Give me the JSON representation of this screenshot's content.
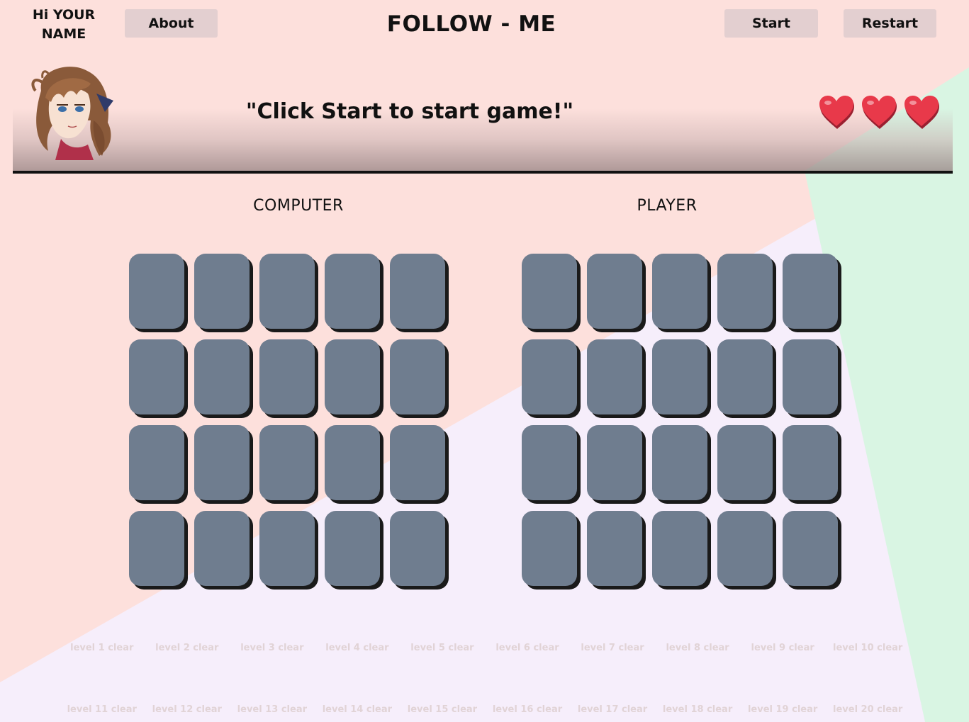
{
  "header": {
    "greeting_line1": "Hi YOUR",
    "greeting_line2": "NAME",
    "title": "FOLLOW - ME",
    "about_label": "About",
    "start_label": "Start",
    "restart_label": "Restart"
  },
  "banner": {
    "avatar_icon": "anime-character-portrait-icon",
    "message": "\"Click Start to start game!\"",
    "lives": 3,
    "heart_icon": "heart-icon",
    "heart_color": "#e8394a"
  },
  "boards": {
    "computer_label": "COMPUTER",
    "player_label": "PLAYER",
    "tile_color": "#6f7d8f"
  },
  "levels": [
    "level 1 clear",
    "level 2 clear",
    "level 3 clear",
    "level 4 clear",
    "level 5 clear",
    "level 6 clear",
    "level 7 clear",
    "level 8 clear",
    "level 9 clear",
    "level 10 clear",
    "level 11 clear",
    "level 12 clear",
    "level 13 clear",
    "level 14 clear",
    "level 15 clear",
    "level 16 clear",
    "level 17 clear",
    "level 18 clear",
    "level 19 clear",
    "level 20 clear"
  ],
  "background_colors": {
    "pink": "#fde0dc",
    "lavender": "#f6eefb",
    "mint": "#d9f5e3"
  }
}
